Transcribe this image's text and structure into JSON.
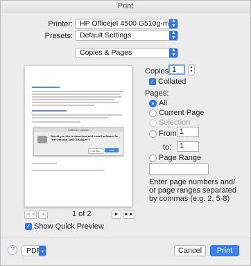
{
  "window": {
    "title": "Print"
  },
  "printer": {
    "label": "Printer:",
    "value": "HP Officejet 4500 G510g-m"
  },
  "presets": {
    "label": "Presets:",
    "value": "Default Settings"
  },
  "section": {
    "value": "Copies & Pages"
  },
  "copies": {
    "label": "Copies:",
    "value": "1",
    "collated_label": "Collated"
  },
  "pages": {
    "label": "Pages:",
    "all_label": "All",
    "current_label": "Current Page",
    "selection_label": "Selection",
    "from_label": "From:",
    "from_value": "1",
    "to_label": "to:",
    "to_value": "1",
    "range_label": "Page Range",
    "help_text_1": "Enter page numbers and/",
    "help_text_2": "or page ranges separated",
    "help_text_3": "by commas (e.g. 2, 5-8)"
  },
  "preview": {
    "page_indicator": "1 of 2",
    "show_preview_label": "Show Quick Preview",
    "dialog_title": "Software Update",
    "dialog_text": "Would you like to download and install software for \"HP Officejet 4500 G510g-m\"?",
    "dialog_ok": "Install",
    "dialog_cancel": "Not Now",
    "prev_first": "◄◄",
    "prev": "◄",
    "next": "►",
    "next_last": "►►"
  },
  "footer": {
    "help": "?",
    "pdf_label": "PDF",
    "cancel_label": "Cancel",
    "print_label": "Print"
  },
  "colors": {
    "accent": "#2f74e8",
    "window_bg": "#ececec"
  }
}
